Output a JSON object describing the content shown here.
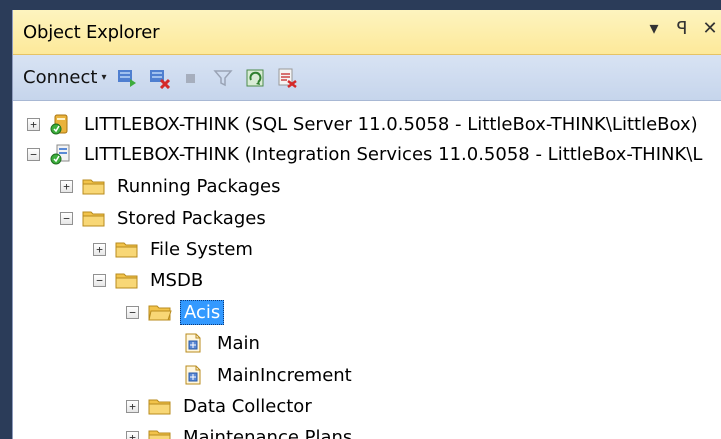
{
  "panel": {
    "title": "Object Explorer",
    "buttons": {
      "dropdown": "▾",
      "pin": "ꟼ",
      "close": "✕"
    }
  },
  "toolbar": {
    "connect_label": "Connect",
    "connect_caret": "▾"
  },
  "tree": [
    {
      "label": "LITTLEBOX-THINK (SQL Server 11.0.5058 - LittleBox-THINK\\LittleBox)",
      "expander": "+",
      "icon": "sql-server-icon"
    },
    {
      "label": "LITTLEBOX-THINK (Integration Services 11.0.5058 - LittleBox-THINK\\L",
      "expander": "−",
      "icon": "integration-services-icon"
    },
    {
      "label": "Running Packages",
      "expander": "+",
      "icon": "folder-icon"
    },
    {
      "label": "Stored Packages",
      "expander": "−",
      "icon": "folder-icon"
    },
    {
      "label": "File System",
      "expander": "+",
      "icon": "folder-icon"
    },
    {
      "label": "MSDB",
      "expander": "−",
      "icon": "folder-icon"
    },
    {
      "label": "Acis",
      "expander": "−",
      "icon": "folder-icon",
      "selected": true
    },
    {
      "label": "Main",
      "expander": "",
      "icon": "package-icon"
    },
    {
      "label": "MainIncrement",
      "expander": "",
      "icon": "package-icon"
    },
    {
      "label": "Data Collector",
      "expander": "+",
      "icon": "folder-icon"
    },
    {
      "label": "Maintenance Plans",
      "expander": "+",
      "icon": "folder-icon"
    }
  ],
  "colors": {
    "selection": "#3399ff",
    "folder": "#f2c34a"
  }
}
